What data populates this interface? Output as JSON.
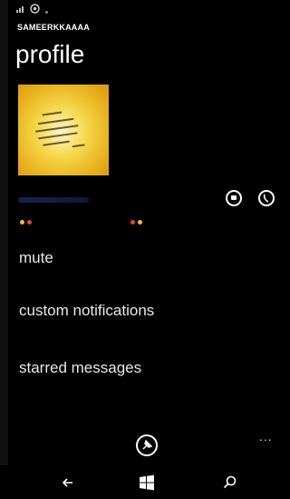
{
  "status_bar": {
    "signal_icon": "signal-icon",
    "notification_icon": "whatsapp-icon"
  },
  "app": {
    "title": "SAMEERKKAAAA",
    "page_title": "profile"
  },
  "profile": {
    "photo_icon": "profile-photo",
    "actions": [
      {
        "icon": "chat-icon"
      },
      {
        "icon": "call-icon"
      }
    ]
  },
  "menu": {
    "items": [
      {
        "label": "mute"
      },
      {
        "label": "custom notifications"
      },
      {
        "label": "starred messages"
      }
    ]
  },
  "app_bar": {
    "pin_icon": "pin-icon",
    "more_icon": "more-icon",
    "more_label": "..."
  },
  "nav": {
    "back_icon": "back-arrow-icon",
    "start_icon": "windows-logo-icon",
    "search_icon": "search-icon"
  },
  "colors": {
    "background": "#000000",
    "dot_red": "#e2453c",
    "dot_yellow": "#f0c02b",
    "photo_yellow": "#f4d74a"
  }
}
